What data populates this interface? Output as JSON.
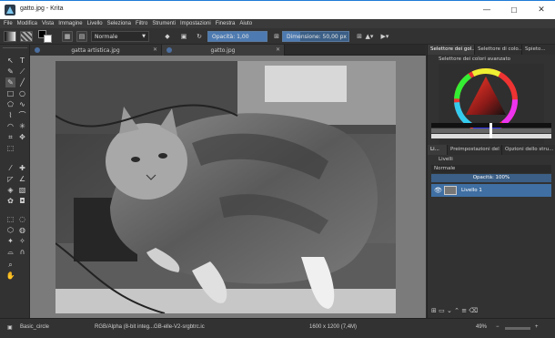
{
  "window": {
    "title": "gatto.jpg - Krita",
    "controls": {
      "minimize": "—",
      "maximize": "☐",
      "close": "✕"
    }
  },
  "menu": [
    "File",
    "Modifica",
    "Vista",
    "Immagine",
    "Livello",
    "Seleziona",
    "Filtro",
    "Strumenti",
    "Impostazioni",
    "Finestra",
    "Aiuto"
  ],
  "toolbar": {
    "blend_mode": "Normale",
    "opacity_label": "Opacità:",
    "opacity_value": "1,00",
    "size_label": "Dimensione:",
    "size_value": "50,00 px"
  },
  "documents": {
    "tabs": [
      {
        "label": "gatta artistica.jpg"
      },
      {
        "label": "gatto.jpg"
      }
    ]
  },
  "dockers": {
    "top_tabs": [
      "Selettore dei gol...",
      "Selettore di colo...",
      "Spieto..."
    ],
    "advanced_selector_title": "Selettore dei colori avanzato",
    "middle_tabs": [
      "Li...",
      "Preimpostazioni del p...",
      "Opzioni dello stru..."
    ],
    "layers_title": "Livelli",
    "layers_blend": "Normale",
    "layers_opacity": "Opacità:  100%",
    "layers": [
      {
        "name": "Livello 1",
        "selected": true
      }
    ]
  },
  "status": {
    "brush": "Basic_circle",
    "color_profile": "RGB/Alpha (8-bit integ...GB-elle-V2-srgbtrc.ic",
    "dimensions": "1600 x 1200 (7,4M)",
    "zoom": "49%"
  }
}
